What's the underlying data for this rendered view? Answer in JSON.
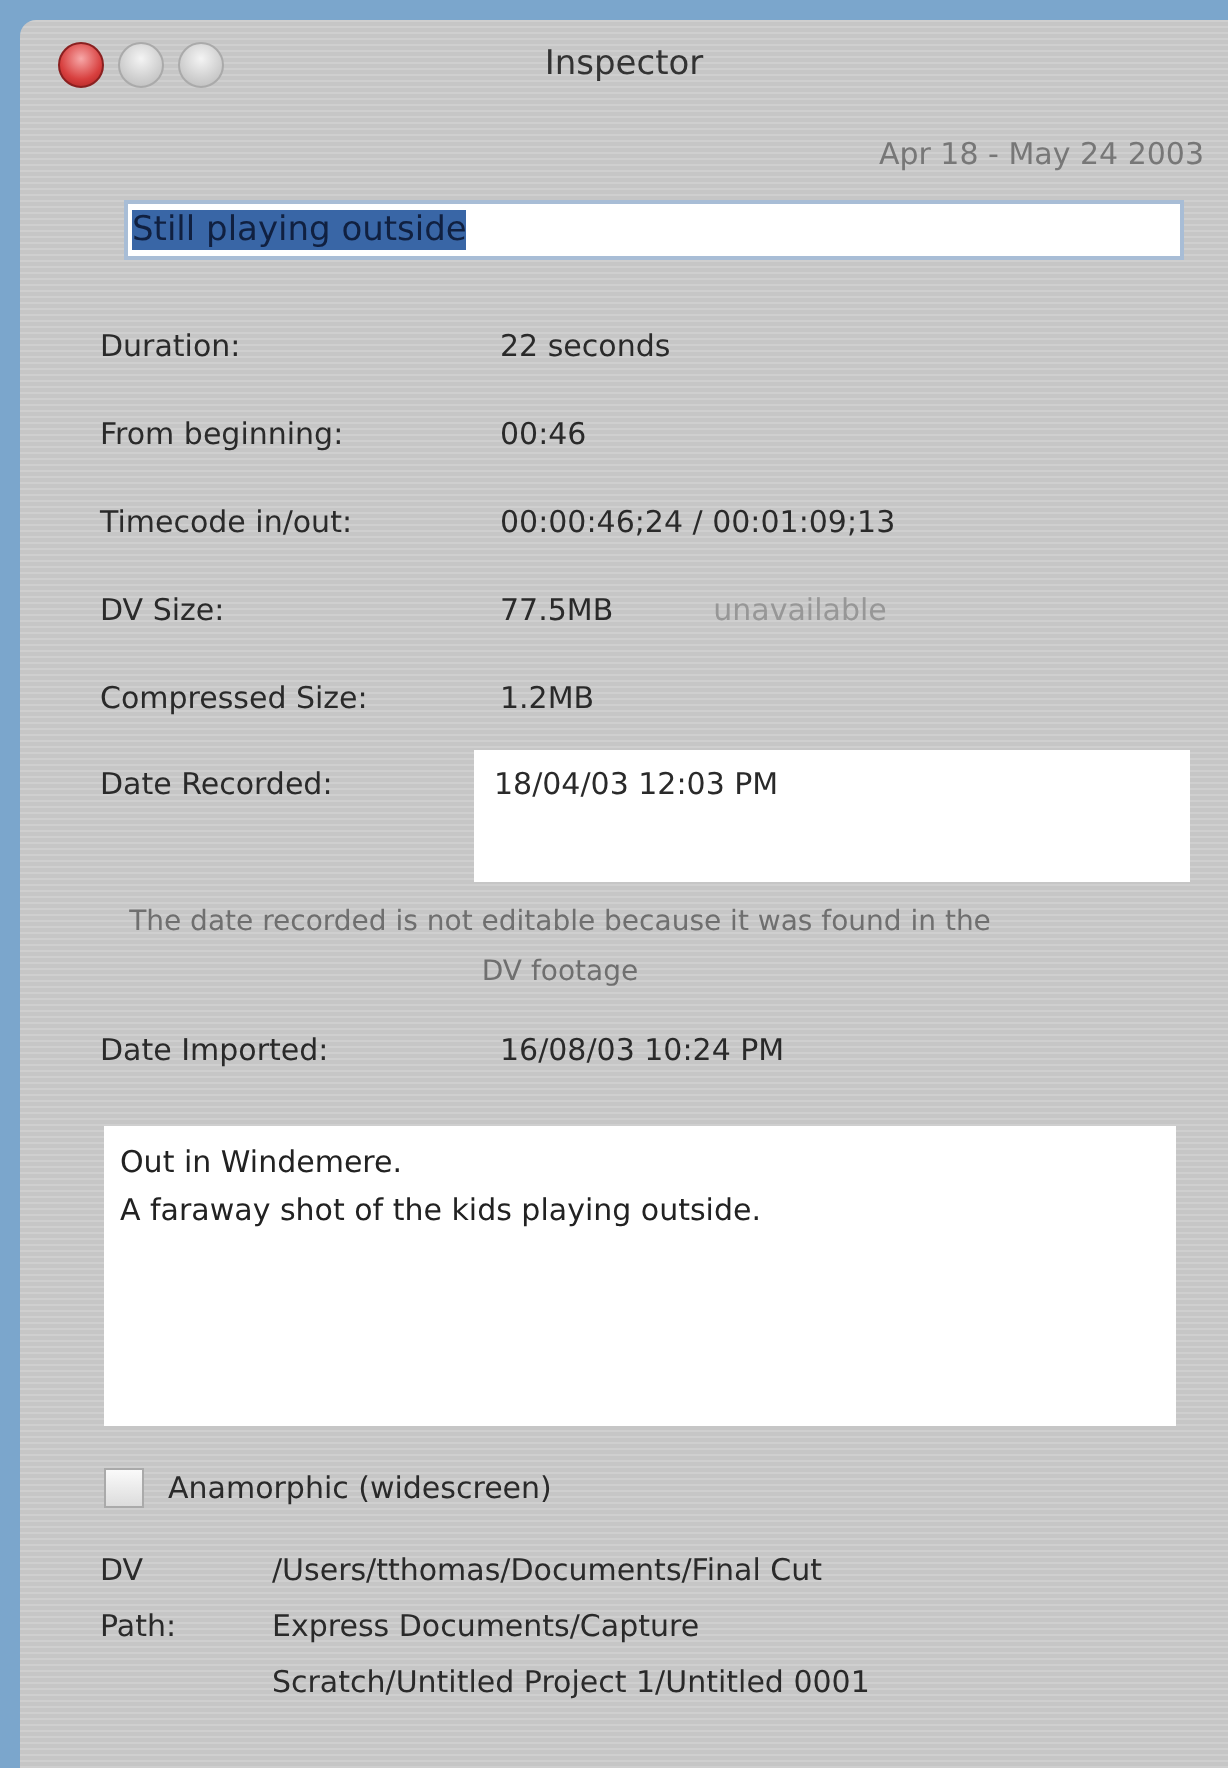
{
  "window": {
    "title": "Inspector"
  },
  "date_range": "Apr 18 - May 24 2003",
  "name_field": {
    "value": "Still playing outside",
    "selected": true
  },
  "rows": [
    {
      "kind": "text",
      "label": "Duration:",
      "value": "22 seconds"
    },
    {
      "kind": "text",
      "label": "From beginning:",
      "value": "00:46"
    },
    {
      "kind": "text",
      "label": "Timecode in/out:",
      "value": "00:00:46;24 / 00:01:09;13"
    },
    {
      "kind": "text",
      "label": "DV Size:",
      "value": "77.5MB",
      "extra": {
        "text": "unavailable",
        "disabled": true
      }
    },
    {
      "kind": "text",
      "label": "Compressed Size:",
      "value": "1.2MB"
    },
    {
      "kind": "field",
      "label": "Date Recorded:",
      "value": "18/04/03 12:03 PM"
    },
    {
      "kind": "note",
      "text": "The date recorded is not editable because it was found in the DV footage"
    },
    {
      "kind": "text",
      "label": "Date Imported:",
      "value": "16/08/03 10:24 PM"
    }
  ],
  "comments": [
    "Out in Windemere.",
    "A faraway shot of the kids playing outside."
  ],
  "anamorphic": {
    "label": "Anamorphic (widescreen)",
    "checked": false
  },
  "dv_path": {
    "label": "DV Path:",
    "value": "/Users/tthomas/Documents/Final Cut Express Documents/Capture Scratch/Untitled Project 1/Untitled 0001"
  }
}
